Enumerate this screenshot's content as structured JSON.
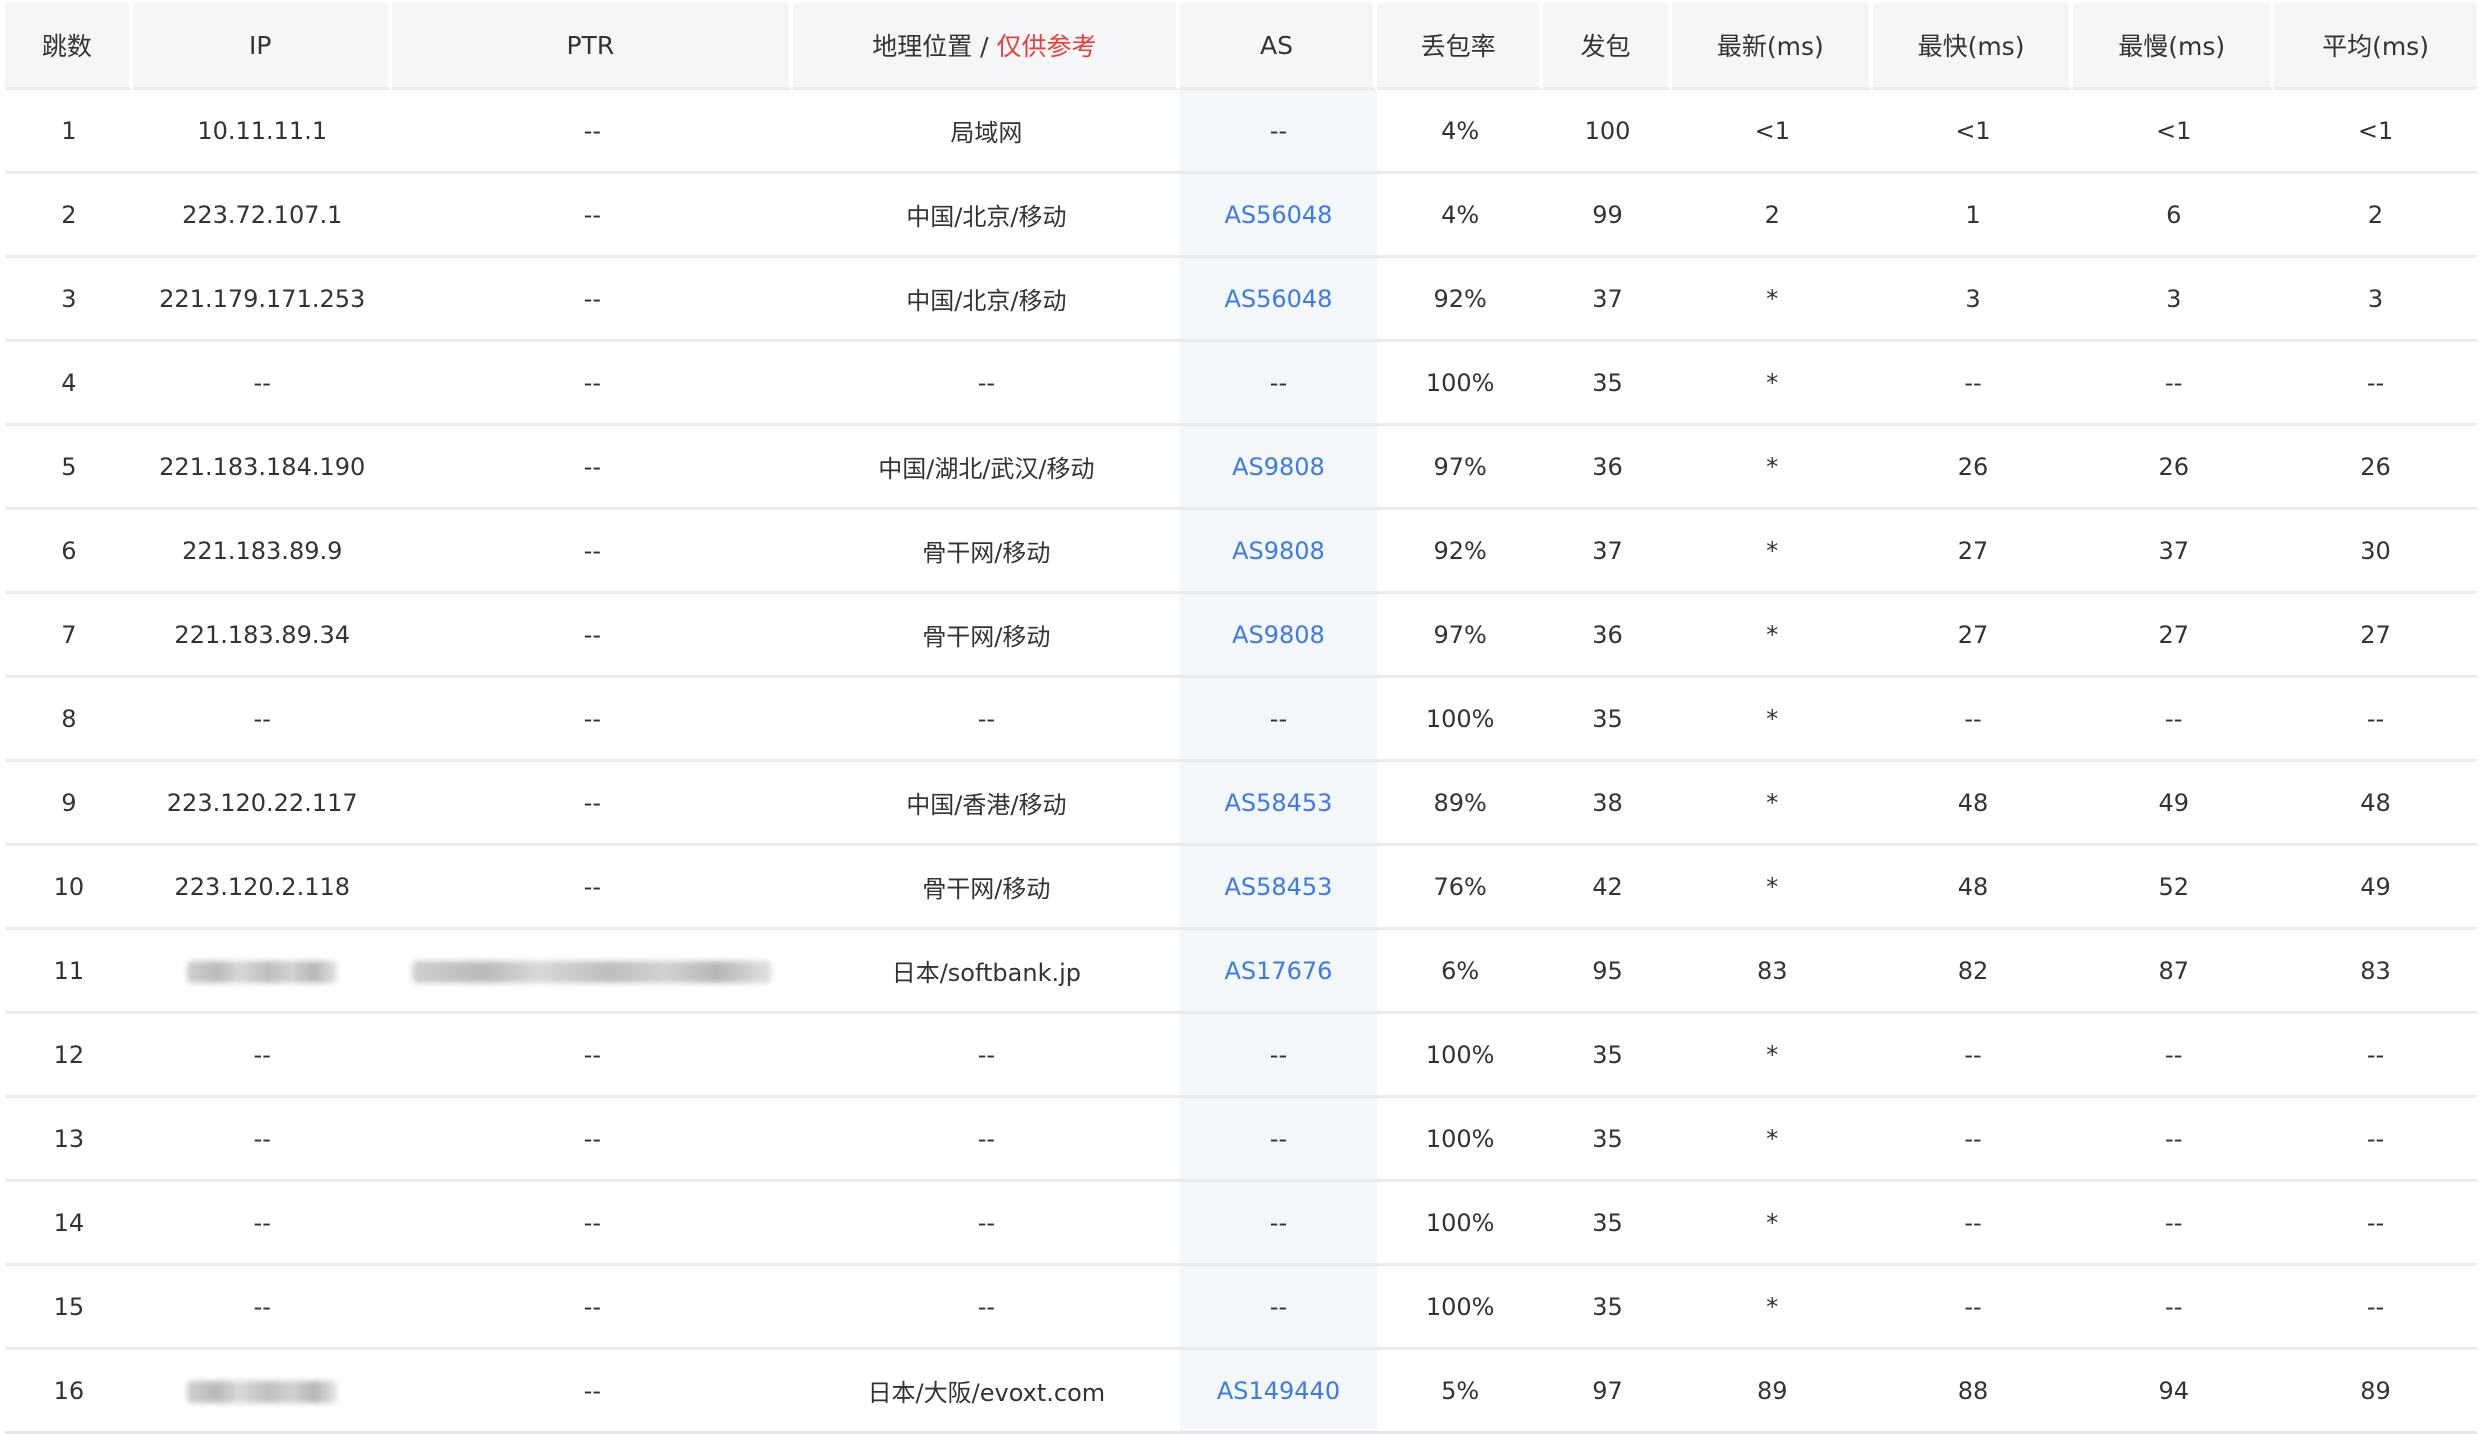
{
  "table": {
    "headers": {
      "hop": "跳数",
      "ip": "IP",
      "ptr": "PTR",
      "geo": "地理位置",
      "geo_sep": " / ",
      "geo_hint": "仅供参考",
      "as": "AS",
      "loss": "丢包率",
      "sent": "发包",
      "last": "最新(ms)",
      "best": "最快(ms)",
      "worst": "最慢(ms)",
      "avg": "平均(ms)"
    },
    "rows": [
      {
        "hop": "1",
        "ip": "10.11.11.1",
        "ptr": "--",
        "geo": "局域网",
        "as": "--",
        "loss": "4%",
        "sent": "100",
        "last": "<1",
        "best": "<1",
        "worst": "<1",
        "avg": "<1"
      },
      {
        "hop": "2",
        "ip": "223.72.107.1",
        "ptr": "--",
        "geo": "中国/北京/移动",
        "as": "AS56048",
        "loss": "4%",
        "sent": "99",
        "last": "2",
        "best": "1",
        "worst": "6",
        "avg": "2"
      },
      {
        "hop": "3",
        "ip": "221.179.171.253",
        "ptr": "--",
        "geo": "中国/北京/移动",
        "as": "AS56048",
        "loss": "92%",
        "sent": "37",
        "last": "*",
        "best": "3",
        "worst": "3",
        "avg": "3"
      },
      {
        "hop": "4",
        "ip": "--",
        "ptr": "--",
        "geo": "--",
        "as": "--",
        "loss": "100%",
        "sent": "35",
        "last": "*",
        "best": "--",
        "worst": "--",
        "avg": "--"
      },
      {
        "hop": "5",
        "ip": "221.183.184.190",
        "ptr": "--",
        "geo": "中国/湖北/武汉/移动",
        "as": "AS9808",
        "loss": "97%",
        "sent": "36",
        "last": "*",
        "best": "26",
        "worst": "26",
        "avg": "26"
      },
      {
        "hop": "6",
        "ip": "221.183.89.9",
        "ptr": "--",
        "geo": "骨干网/移动",
        "as": "AS9808",
        "loss": "92%",
        "sent": "37",
        "last": "*",
        "best": "27",
        "worst": "37",
        "avg": "30"
      },
      {
        "hop": "7",
        "ip": "221.183.89.34",
        "ptr": "--",
        "geo": "骨干网/移动",
        "as": "AS9808",
        "loss": "97%",
        "sent": "36",
        "last": "*",
        "best": "27",
        "worst": "27",
        "avg": "27"
      },
      {
        "hop": "8",
        "ip": "--",
        "ptr": "--",
        "geo": "--",
        "as": "--",
        "loss": "100%",
        "sent": "35",
        "last": "*",
        "best": "--",
        "worst": "--",
        "avg": "--"
      },
      {
        "hop": "9",
        "ip": "223.120.22.117",
        "ptr": "--",
        "geo": "中国/香港/移动",
        "as": "AS58453",
        "loss": "89%",
        "sent": "38",
        "last": "*",
        "best": "48",
        "worst": "49",
        "avg": "48"
      },
      {
        "hop": "10",
        "ip": "223.120.2.118",
        "ptr": "--",
        "geo": "骨干网/移动",
        "as": "AS58453",
        "loss": "76%",
        "sent": "42",
        "last": "*",
        "best": "48",
        "worst": "52",
        "avg": "49"
      },
      {
        "hop": "11",
        "ip": "",
        "ip_redacted": true,
        "ptr": "",
        "ptr_redacted": true,
        "geo": "日本/softbank.jp",
        "as": "AS17676",
        "loss": "6%",
        "sent": "95",
        "last": "83",
        "best": "82",
        "worst": "87",
        "avg": "83"
      },
      {
        "hop": "12",
        "ip": "--",
        "ptr": "--",
        "geo": "--",
        "as": "--",
        "loss": "100%",
        "sent": "35",
        "last": "*",
        "best": "--",
        "worst": "--",
        "avg": "--"
      },
      {
        "hop": "13",
        "ip": "--",
        "ptr": "--",
        "geo": "--",
        "as": "--",
        "loss": "100%",
        "sent": "35",
        "last": "*",
        "best": "--",
        "worst": "--",
        "avg": "--"
      },
      {
        "hop": "14",
        "ip": "--",
        "ptr": "--",
        "geo": "--",
        "as": "--",
        "loss": "100%",
        "sent": "35",
        "last": "*",
        "best": "--",
        "worst": "--",
        "avg": "--"
      },
      {
        "hop": "15",
        "ip": "--",
        "ptr": "--",
        "geo": "--",
        "as": "--",
        "loss": "100%",
        "sent": "35",
        "last": "*",
        "best": "--",
        "worst": "--",
        "avg": "--"
      },
      {
        "hop": "16",
        "ip": "",
        "ip_redacted": true,
        "ptr": "--",
        "geo": "日本/大阪/evoxt.com",
        "as": "AS149440",
        "loss": "5%",
        "sent": "97",
        "last": "89",
        "best": "88",
        "worst": "94",
        "avg": "89"
      }
    ]
  },
  "colors": {
    "as_link": "#3c7ae6",
    "hint_red": "#e8413a",
    "header_bg": "#f5f6f7",
    "as_cell_bg": "#f4f7fa"
  }
}
